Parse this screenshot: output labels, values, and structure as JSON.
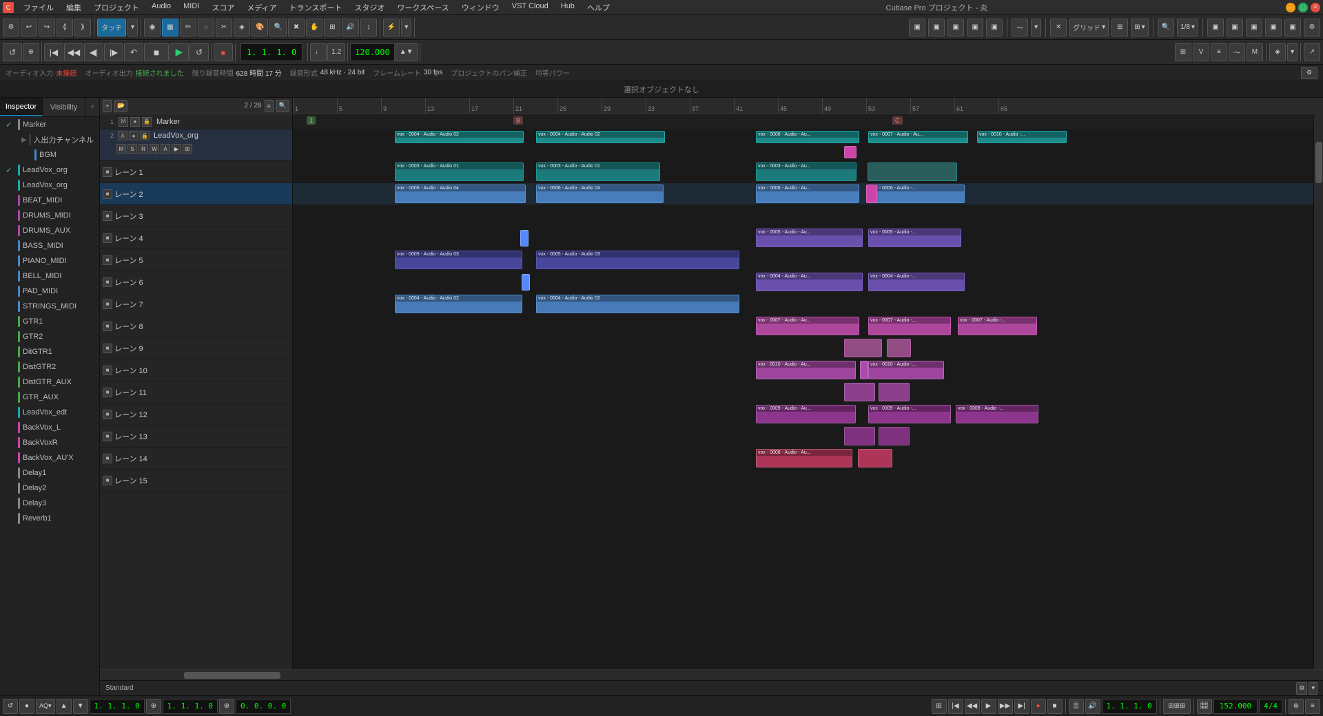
{
  "app": {
    "title": "Cubase Pro プロジェクト - 炎",
    "icon": "C"
  },
  "menu": {
    "items": [
      "ファイル",
      "編集",
      "プロジェクト",
      "Audio",
      "MIDI",
      "スコア",
      "メディア",
      "トランスポート",
      "スタジオ",
      "ワークスペース",
      "ウィンドウ",
      "VST Cloud",
      "Hub",
      "ヘルプ"
    ]
  },
  "window_controls": {
    "minimize": "—",
    "maximize": "□",
    "close": "✕"
  },
  "toolbar": {
    "touch_label": "タッチ",
    "grid_label": "グリッド",
    "quantize_label": "1/8"
  },
  "info_bar": {
    "audio_in": "オーディオ入力",
    "disconnected": "未接続",
    "audio_out": "オーディオ出力",
    "connected": "接続されました",
    "remaining_time": "残り録音時間",
    "time_value": "628 時間 17 分",
    "audio_format": "録音形式",
    "format_value": "48 kHz · 24 bit",
    "frame_rate_label": "フレームレート",
    "frame_rate_value": "30 fps",
    "pan_label": "プロジェクトのパン補正",
    "power_label": "均等パワー"
  },
  "selected_object": "選択オブジェクトなし",
  "inspector": {
    "tab_inspector": "Inspector",
    "tab_visibility": "Visibility",
    "close_label": "×"
  },
  "track_list": {
    "items": [
      {
        "name": "Marker",
        "checked": true,
        "color": "#888",
        "indent": 0
      },
      {
        "name": "入出力チャンネル",
        "checked": false,
        "color": "#888",
        "indent": 1,
        "expand": true
      },
      {
        "name": "BGM",
        "checked": false,
        "color": "#4488cc",
        "indent": 2
      },
      {
        "name": "LeadVox_org",
        "checked": true,
        "color": "#1aa8a8",
        "indent": 0
      },
      {
        "name": "LeadVox_org",
        "checked": false,
        "color": "#1aa8a8",
        "indent": 0
      },
      {
        "name": "BEAT_MIDI",
        "checked": false,
        "color": "#aa44aa",
        "indent": 0
      },
      {
        "name": "DRUMS_MIDI",
        "checked": false,
        "color": "#aa44aa",
        "indent": 0
      },
      {
        "name": "DRUMS_AUX",
        "checked": false,
        "color": "#aa44aa",
        "indent": 0
      },
      {
        "name": "BASS_MIDI",
        "checked": false,
        "color": "#4488cc",
        "indent": 0
      },
      {
        "name": "PIANO_MIDI",
        "checked": false,
        "color": "#4488cc",
        "indent": 0
      },
      {
        "name": "BELL_MIDI",
        "checked": false,
        "color": "#4488cc",
        "indent": 0
      },
      {
        "name": "PAD_MIDI",
        "checked": false,
        "color": "#4488cc",
        "indent": 0
      },
      {
        "name": "STRINGS_MIDI",
        "checked": false,
        "color": "#4488cc",
        "indent": 0
      },
      {
        "name": "GTR1",
        "checked": false,
        "color": "#44aa44",
        "indent": 0
      },
      {
        "name": "GTR2",
        "checked": false,
        "color": "#44aa44",
        "indent": 0
      },
      {
        "name": "DitGTR1",
        "checked": false,
        "color": "#44aa44",
        "indent": 0
      },
      {
        "name": "DistGTR2",
        "checked": false,
        "color": "#44aa44",
        "indent": 0
      },
      {
        "name": "DistGTR_AUX",
        "checked": false,
        "color": "#44aa44",
        "indent": 0
      },
      {
        "name": "GTR_AUX",
        "checked": false,
        "color": "#44aa44",
        "indent": 0
      },
      {
        "name": "LeadVox_edt",
        "checked": false,
        "color": "#1aa8a8",
        "indent": 0
      },
      {
        "name": "BackVox_L",
        "checked": false,
        "color": "#cc44aa",
        "indent": 0
      },
      {
        "name": "BackVoxR",
        "checked": false,
        "color": "#cc44aa",
        "indent": 0
      },
      {
        "name": "BackVox_AU'X",
        "checked": false,
        "color": "#cc44aa",
        "indent": 0
      },
      {
        "name": "Delay1",
        "checked": false,
        "color": "#888",
        "indent": 0
      },
      {
        "name": "Delay2",
        "checked": false,
        "color": "#888",
        "indent": 0
      },
      {
        "name": "Delay3",
        "checked": false,
        "color": "#888",
        "indent": 0
      },
      {
        "name": "Reverb1",
        "checked": false,
        "color": "#888",
        "indent": 0
      }
    ]
  },
  "lanes": {
    "marker_label": "Marker",
    "leadvox_label": "LeadVox_org",
    "count_display": "2 / 28",
    "standard_label": "Standard",
    "lanes": [
      {
        "label": "レーン 1",
        "num": "",
        "type": "regular"
      },
      {
        "label": "レーン 2",
        "num": "",
        "type": "regular",
        "selected": true
      },
      {
        "label": "レーン 3",
        "num": "",
        "type": "regular"
      },
      {
        "label": "レーン 4",
        "num": "",
        "type": "regular"
      },
      {
        "label": "レーン 5",
        "num": "",
        "type": "regular"
      },
      {
        "label": "レーン 6",
        "num": "",
        "type": "regular"
      },
      {
        "label": "レーン 7",
        "num": "",
        "type": "regular"
      },
      {
        "label": "レーン 8",
        "num": "",
        "type": "regular"
      },
      {
        "label": "レーン 9",
        "num": "",
        "type": "regular"
      },
      {
        "label": "レーン 10",
        "num": "",
        "type": "regular"
      },
      {
        "label": "レーン 11",
        "num": "",
        "type": "regular"
      },
      {
        "label": "レーン 12",
        "num": "",
        "type": "regular"
      },
      {
        "label": "レーン 13",
        "num": "",
        "type": "regular"
      },
      {
        "label": "レーン 14",
        "num": "",
        "type": "regular"
      },
      {
        "label": "レーン 15",
        "num": "",
        "type": "regular"
      }
    ]
  },
  "ruler": {
    "ticks": [
      1,
      5,
      9,
      13,
      17,
      21,
      25,
      29,
      33,
      37,
      41,
      45,
      49,
      53,
      57,
      61,
      65
    ]
  },
  "bottom_transport": {
    "position": "1. 1. 1. 0",
    "position2": "1. 1. 1. 0",
    "position3": "0. 0. 0. 0",
    "position4": "1. 1. 1. 0",
    "tempo": "152.000",
    "signature": "4/4"
  },
  "colors": {
    "accent_blue": "#1a7ab5",
    "clip_turquoise": "#1aa8a8",
    "clip_purple": "#7755cc",
    "clip_blue": "#4488cc",
    "clip_pink": "#cc44aa"
  }
}
